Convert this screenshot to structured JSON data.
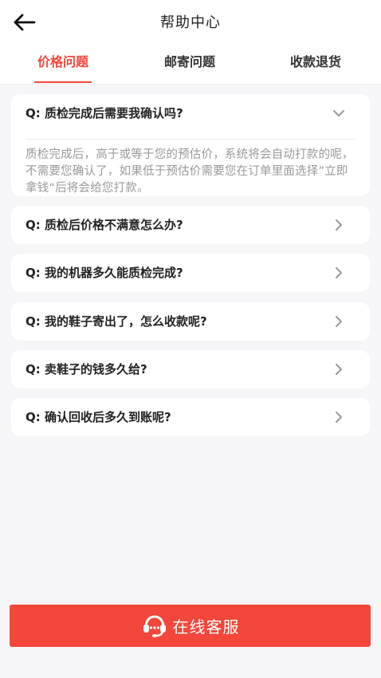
{
  "header": {
    "title": "帮助中心"
  },
  "tabs": [
    {
      "label": "价格问题",
      "active": true
    },
    {
      "label": "邮寄问题",
      "active": false
    },
    {
      "label": "收款退货",
      "active": false
    }
  ],
  "faqs": [
    {
      "question": "Q: 质检完成后需要我确认吗?",
      "expanded": true,
      "answer": "质检完成后，高于或等于您的预估价，系统将会自动打款的呢，不需要您确认了，如果低于预估价需要您在订单里面选择”立即拿钱“后将会给您打款。"
    },
    {
      "question": "Q: 质检后价格不满意怎么办?",
      "expanded": false
    },
    {
      "question": "Q: 我的机器多久能质检完成?",
      "expanded": false
    },
    {
      "question": "Q: 我的鞋子寄出了，怎么收款呢?",
      "expanded": false
    },
    {
      "question": "Q: 卖鞋子的钱多久给?",
      "expanded": false
    },
    {
      "question": "Q: 确认回收后多久到账呢?",
      "expanded": false
    }
  ],
  "footer": {
    "service_label": "在线客服"
  },
  "colors": {
    "accent": "#f2473a",
    "background": "#f6f6f8"
  },
  "icons": {
    "back": "arrow-left-icon",
    "expand": "chevron-down-icon",
    "collapse": "chevron-right-icon",
    "service": "headset-icon"
  }
}
